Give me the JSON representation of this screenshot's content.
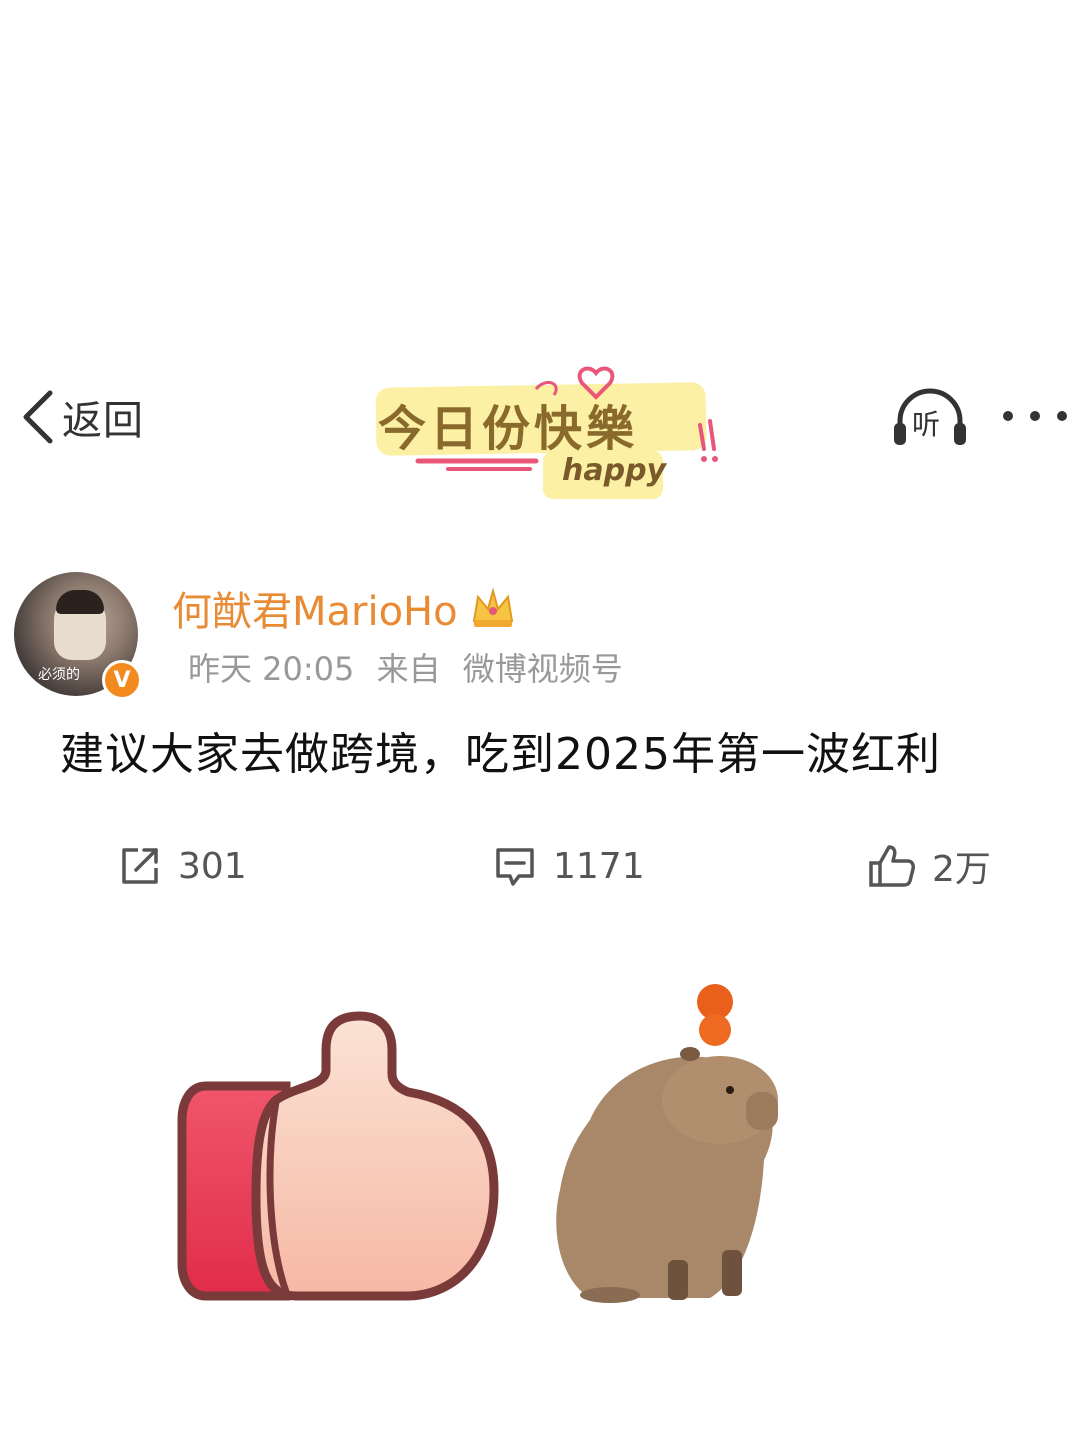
{
  "nav": {
    "back_label": "返回",
    "sticker_title": "今日份快樂",
    "sticker_sub": "happy",
    "listen_label": "听"
  },
  "post": {
    "avatar_caption": "必须的",
    "verified_mark": "V",
    "username": "何猷君MarioHo",
    "time": "昨天 20:05",
    "source_prefix": "来自",
    "source": "微博视频号",
    "text": "建议大家去做跨境，吃到2025年第一波红利"
  },
  "actions": {
    "repost_count": "301",
    "comment_count": "1171",
    "like_count": "2万"
  },
  "colors": {
    "username": "#e98b35",
    "meta": "#999999",
    "verified": "#f28a1e",
    "sticker_bg": "#fbf0a4"
  },
  "icons": [
    "chevron-left-icon",
    "headphones-icon",
    "more-icon",
    "crown-icon",
    "repost-icon",
    "comment-icon",
    "like-icon",
    "thumbs-up-sticker",
    "capybara-sticker"
  ]
}
